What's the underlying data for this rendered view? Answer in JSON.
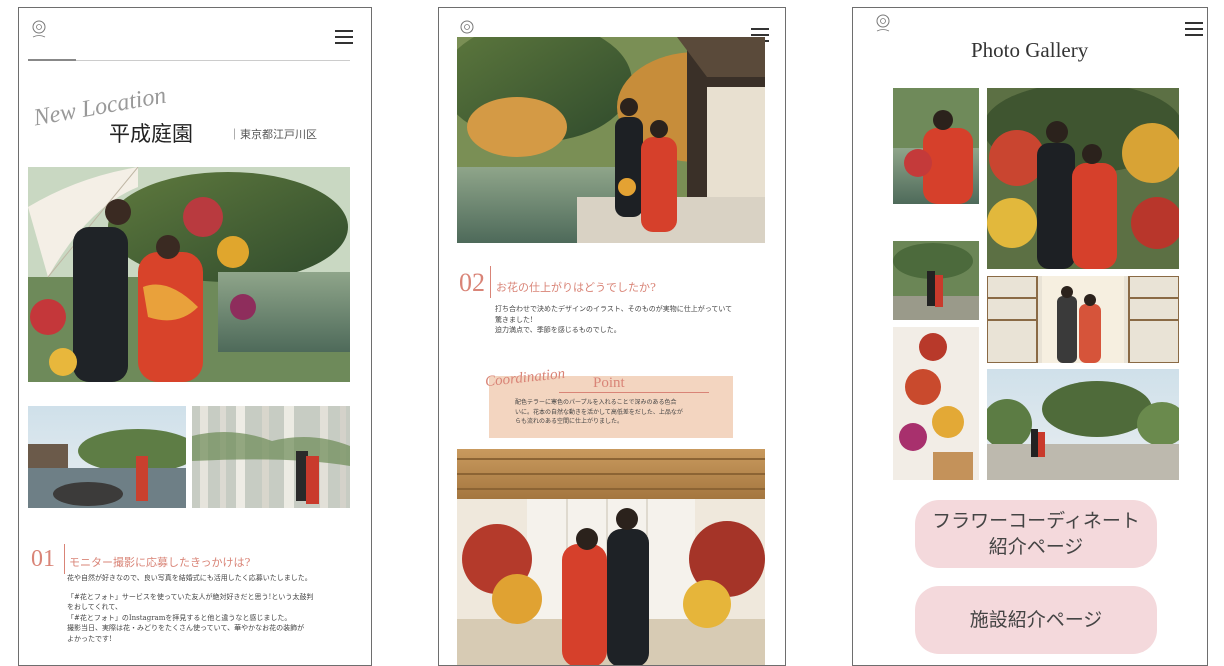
{
  "screen1": {
    "script_title": "New Location",
    "venue_name": "平成庭園",
    "area": "東京都江戸川区",
    "q1_number": "01",
    "q1_title": "モニター撮影に応募したきっかけは?",
    "q1_lines": [
      "花や自然が好きなので、良い写真を結婚式にも活用したく応募いたしました。",
      "",
      "「#花とフォト」サービスを使っていた友人が絶対好きだと思う!という太鼓判",
      "をおしてくれて、",
      "「#花とフォト」のInstagramを拝見すると他と違うなと感じました。",
      "撮影当日、実際は花・みどりをたくさん使っていて、華やかなお花の装飾が",
      "よかったです!"
    ]
  },
  "screen2": {
    "q2_number": "02",
    "q2_title": "お花の仕上がりはどうでしたか?",
    "q2_lines": [
      "打ち合わせで決めたデザインのイラスト、そのものが実物に仕上がっていて",
      "驚きました!",
      "迫力満点で、季節を感じるものでした。"
    ],
    "point_script": "Coordination",
    "point_title": "Point",
    "point_lines": [
      "配色テラーに寒色のパープルを入れることで深みのある色合",
      "いに。花本の自然な動きを活かして高低差をだした、上品なが",
      "らも流れのある空間に仕上がりました。"
    ]
  },
  "screen3": {
    "gallery_title": "Photo Gallery",
    "button_flower_lines": [
      "フラワーコーディネート",
      "紹介ページ"
    ],
    "button_facility": "施設紹介ページ"
  },
  "icons": {
    "logo": "floral-logo-icon",
    "menu": "hamburger-menu-icon"
  },
  "colors": {
    "accent": "#d98477",
    "button_bg": "#f4d9dc",
    "point_box": "#f3d5c0"
  }
}
